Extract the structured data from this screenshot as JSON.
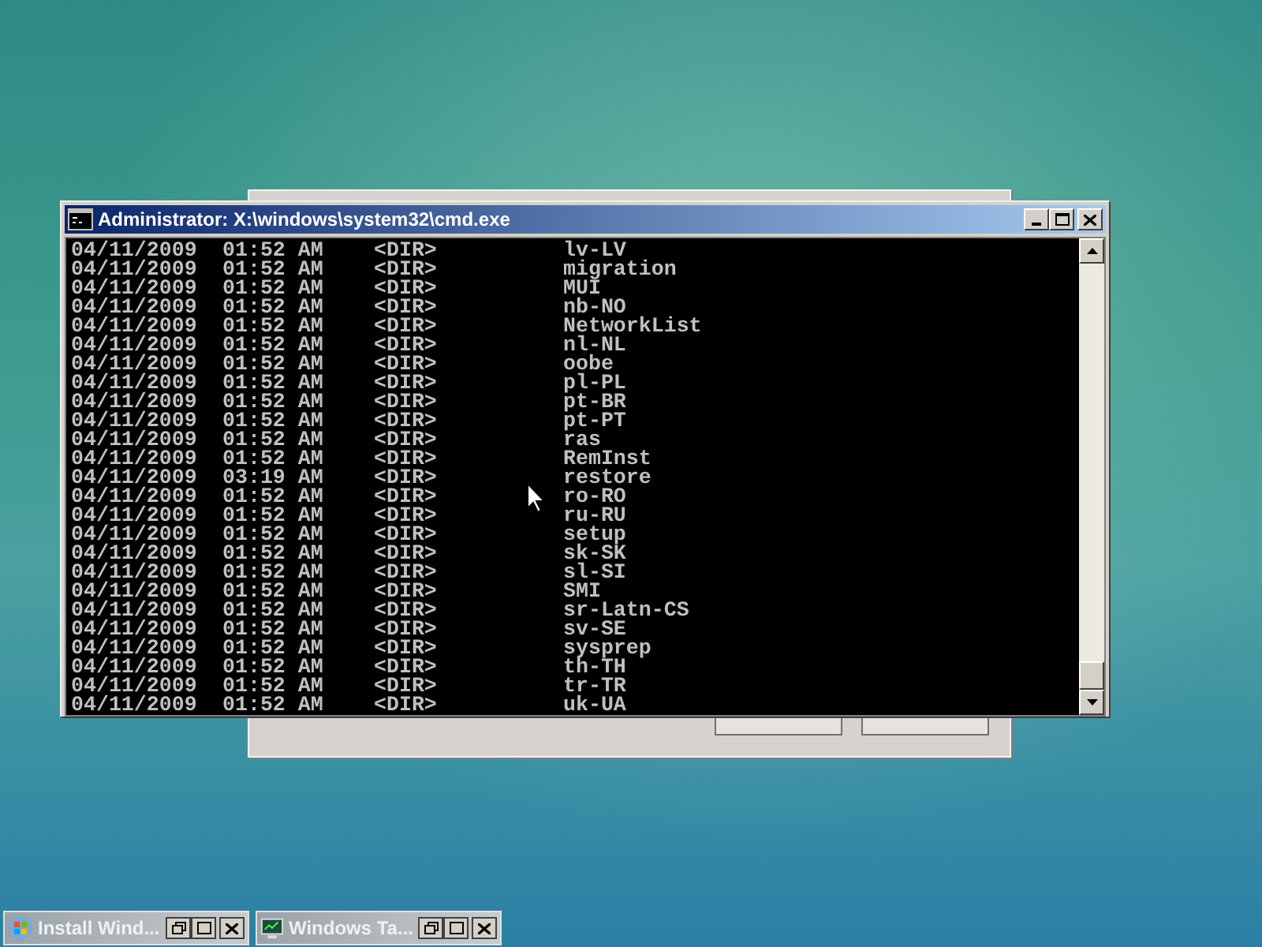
{
  "window": {
    "title": "Administrator: X:\\windows\\system32\\cmd.exe"
  },
  "console_rows": [
    {
      "date": "04/11/2009",
      "time": "01:52 AM",
      "type": "<DIR>",
      "name": "lv-LV"
    },
    {
      "date": "04/11/2009",
      "time": "01:52 AM",
      "type": "<DIR>",
      "name": "migration"
    },
    {
      "date": "04/11/2009",
      "time": "01:52 AM",
      "type": "<DIR>",
      "name": "MUI"
    },
    {
      "date": "04/11/2009",
      "time": "01:52 AM",
      "type": "<DIR>",
      "name": "nb-NO"
    },
    {
      "date": "04/11/2009",
      "time": "01:52 AM",
      "type": "<DIR>",
      "name": "NetworkList"
    },
    {
      "date": "04/11/2009",
      "time": "01:52 AM",
      "type": "<DIR>",
      "name": "nl-NL"
    },
    {
      "date": "04/11/2009",
      "time": "01:52 AM",
      "type": "<DIR>",
      "name": "oobe"
    },
    {
      "date": "04/11/2009",
      "time": "01:52 AM",
      "type": "<DIR>",
      "name": "pl-PL"
    },
    {
      "date": "04/11/2009",
      "time": "01:52 AM",
      "type": "<DIR>",
      "name": "pt-BR"
    },
    {
      "date": "04/11/2009",
      "time": "01:52 AM",
      "type": "<DIR>",
      "name": "pt-PT"
    },
    {
      "date": "04/11/2009",
      "time": "01:52 AM",
      "type": "<DIR>",
      "name": "ras"
    },
    {
      "date": "04/11/2009",
      "time": "01:52 AM",
      "type": "<DIR>",
      "name": "RemInst"
    },
    {
      "date": "04/11/2009",
      "time": "03:19 AM",
      "type": "<DIR>",
      "name": "restore"
    },
    {
      "date": "04/11/2009",
      "time": "01:52 AM",
      "type": "<DIR>",
      "name": "ro-RO"
    },
    {
      "date": "04/11/2009",
      "time": "01:52 AM",
      "type": "<DIR>",
      "name": "ru-RU"
    },
    {
      "date": "04/11/2009",
      "time": "01:52 AM",
      "type": "<DIR>",
      "name": "setup"
    },
    {
      "date": "04/11/2009",
      "time": "01:52 AM",
      "type": "<DIR>",
      "name": "sk-SK"
    },
    {
      "date": "04/11/2009",
      "time": "01:52 AM",
      "type": "<DIR>",
      "name": "sl-SI"
    },
    {
      "date": "04/11/2009",
      "time": "01:52 AM",
      "type": "<DIR>",
      "name": "SMI"
    },
    {
      "date": "04/11/2009",
      "time": "01:52 AM",
      "type": "<DIR>",
      "name": "sr-Latn-CS"
    },
    {
      "date": "04/11/2009",
      "time": "01:52 AM",
      "type": "<DIR>",
      "name": "sv-SE"
    },
    {
      "date": "04/11/2009",
      "time": "01:52 AM",
      "type": "<DIR>",
      "name": "sysprep"
    },
    {
      "date": "04/11/2009",
      "time": "01:52 AM",
      "type": "<DIR>",
      "name": "th-TH"
    },
    {
      "date": "04/11/2009",
      "time": "01:52 AM",
      "type": "<DIR>",
      "name": "tr-TR"
    },
    {
      "date": "04/11/2009",
      "time": "01:52 AM",
      "type": "<DIR>",
      "name": "uk-UA"
    }
  ],
  "minimized_windows": [
    {
      "title": "Install Wind...",
      "kind": "setup"
    },
    {
      "title": "Windows Ta...",
      "kind": "taskmgr"
    }
  ]
}
